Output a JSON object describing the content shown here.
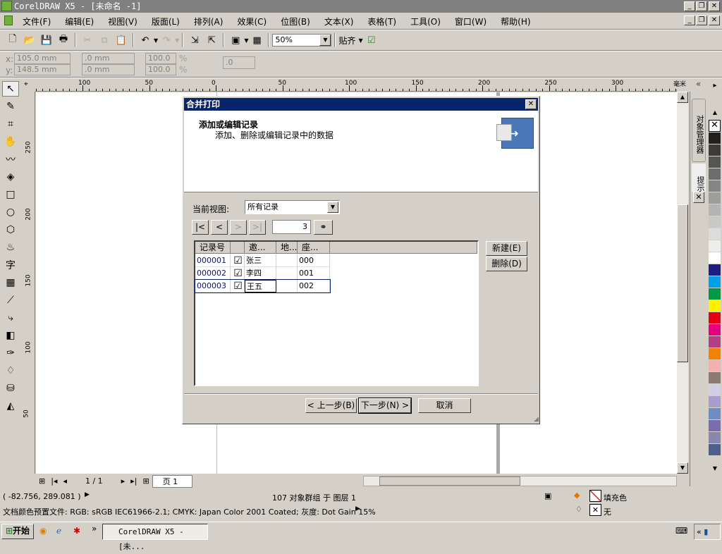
{
  "app": {
    "title": "CorelDRAW X5 - [未命名 -1]"
  },
  "menu": [
    "文件(F)",
    "编辑(E)",
    "视图(V)",
    "版面(L)",
    "排列(A)",
    "效果(C)",
    "位图(B)",
    "文本(X)",
    "表格(T)",
    "工具(O)",
    "窗口(W)",
    "帮助(H)"
  ],
  "toolbar": {
    "zoom": "50%",
    "snap": "贴齐"
  },
  "propbar": {
    "x_label": "x:",
    "y_label": "y:",
    "x": "105.0 mm",
    "y": "148.5 mm",
    "w": ".0 mm",
    "h": ".0 mm",
    "sx": "100.0",
    "sy": "100.0",
    "pct": "%",
    "angle": ".0"
  },
  "ruler": {
    "top": [
      "100",
      "50",
      "0",
      "50",
      "100",
      "150",
      "200",
      "250",
      "300"
    ],
    "left": [
      "250",
      "200",
      "150",
      "100",
      "50"
    ],
    "unit": "毫米"
  },
  "dialog": {
    "title": "合并打印",
    "heading": "添加或编辑记录",
    "subheading": "添加、删除或编辑记录中的数据",
    "view_label": "当前视图:",
    "view_value": "所有记录",
    "nav": [
      "|<",
      "<",
      ">",
      ">|"
    ],
    "record_number": "3",
    "columns": [
      "记录号",
      "",
      "邀...",
      "地...",
      "座..."
    ],
    "rows": [
      [
        "000001",
        "☑",
        "张三",
        "",
        "000"
      ],
      [
        "000002",
        "☑",
        "李四",
        "",
        "001"
      ],
      [
        "000003",
        "☑",
        "王五",
        "",
        "002"
      ]
    ],
    "new_btn": "新建(E)",
    "delete_btn": "删除(D)",
    "back_btn": "< 上一步(B)",
    "next_btn": "下一步(N) >",
    "cancel_btn": "取消"
  },
  "pages": {
    "count": "1 / 1",
    "tab": "页 1"
  },
  "docker": {
    "tabs": [
      "对象管理器",
      "提示"
    ]
  },
  "palette": [
    "#231f20",
    "#3d3a3a",
    "#555",
    "#6d6d6d",
    "#858585",
    "#9d9d9d",
    "#b4b4b4",
    "#c8c8c8",
    "#dcdcdc",
    "#ededed",
    "#ffffff",
    "#1e1e82",
    "#00a0e9",
    "#009944",
    "#fff100",
    "#e60012",
    "#e4007f",
    "#b13f84",
    "#f08300",
    "#f3b0b0",
    "#8b7b70",
    "#d0cfe5",
    "#a79ecb",
    "#6f8dc5",
    "#7a6cae",
    "#8a86ad",
    "#4e5f8c"
  ],
  "status": {
    "coords": "( -82.756, 289.081 )",
    "selection": "107 对象群组 于 图层 1",
    "profile": "文档颜色预置文件: RGB: sRGB IEC61966-2.1; CMYK: Japan Color 2001 Coated; 灰度: Dot Gain 15%",
    "fill": "填充色",
    "outline": "无"
  },
  "taskbar": {
    "start": "开始",
    "task": "CorelDRAW X5 - [未..."
  }
}
